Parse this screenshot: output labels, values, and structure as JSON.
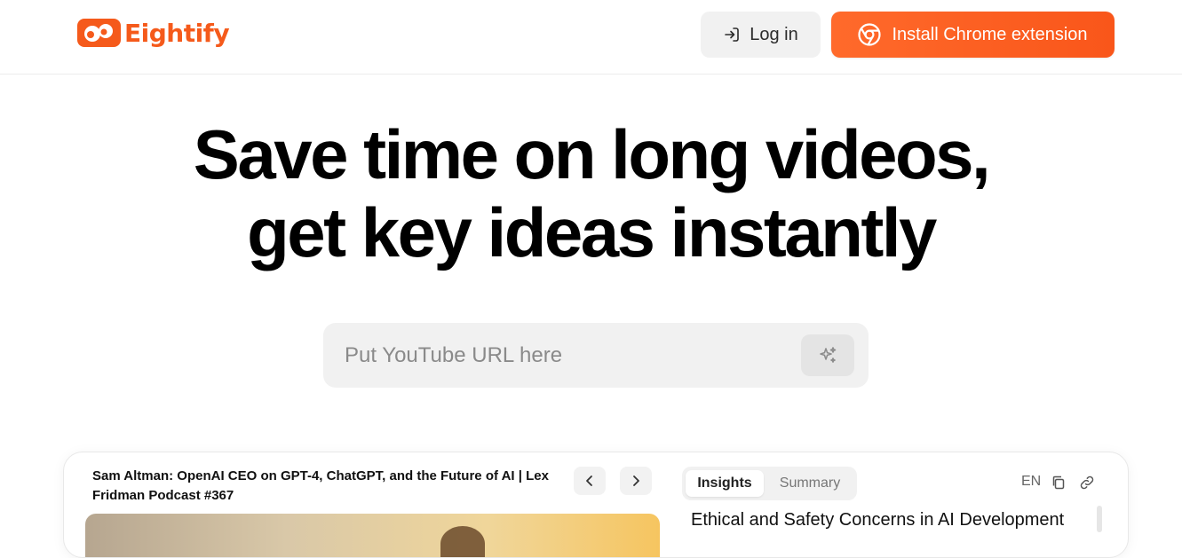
{
  "header": {
    "logo_text": "Eightify",
    "login_label": "Log in",
    "install_label": "Install Chrome extension"
  },
  "hero": {
    "line1": "Save time on long videos,",
    "line2": "get key ideas instantly"
  },
  "search": {
    "placeholder": "Put YouTube URL here"
  },
  "preview": {
    "video_title": "Sam Altman: OpenAI CEO on GPT-4, ChatGPT, and the Future of AI | Lex Fridman Podcast #367",
    "tabs": [
      {
        "label": "Insights",
        "active": true
      },
      {
        "label": "Summary",
        "active": false
      }
    ],
    "language": "EN",
    "section_title": "Ethical and Safety Concerns in AI Development"
  },
  "colors": {
    "brand": "#f55a1b",
    "button_gray": "#f1f1f1",
    "text": "#0a0a0a"
  },
  "icons": [
    "logo-icon",
    "login-icon",
    "chrome-icon",
    "sparkle-icon",
    "chevron-left-icon",
    "chevron-right-icon",
    "copy-icon",
    "link-icon"
  ]
}
